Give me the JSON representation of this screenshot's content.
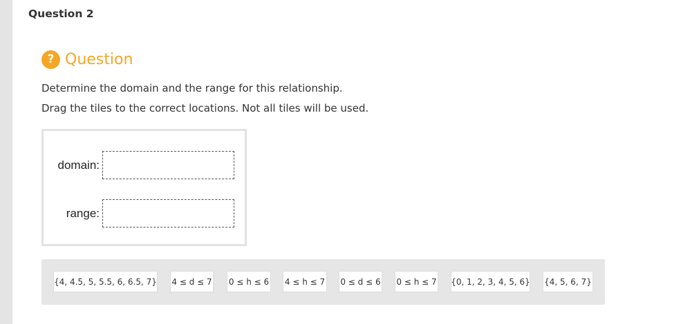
{
  "question_number": "Question 2",
  "header": {
    "badge": "?",
    "label": "Question"
  },
  "instructions": [
    "Determine the domain and the range for this relationship.",
    "Drag the tiles to the correct locations. Not all tiles will be used."
  ],
  "drop_targets": [
    {
      "label": "domain:",
      "value": ""
    },
    {
      "label": "range:",
      "value": ""
    }
  ],
  "tiles": [
    "{4, 4.5, 5, 5.5, 6, 6.5, 7}",
    "4 ≤ d ≤ 7",
    "0 ≤ h ≤ 6",
    "4 ≤ h ≤ 7",
    "0 ≤ d ≤ 6",
    "0 ≤ h ≤ 7",
    "{0, 1, 2, 3, 4, 5, 6}",
    "{4, 5, 6, 7}"
  ],
  "colors": {
    "accent": "#f5a623",
    "tray": "#e6e6e6",
    "panel_border": "#e2e2e2"
  }
}
